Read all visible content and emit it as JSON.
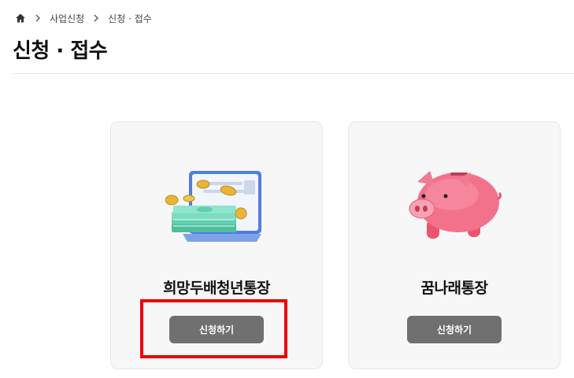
{
  "breadcrumb": {
    "home_icon": "home-icon",
    "separator_icon": "chevron-right-icon",
    "items": [
      "사업신청",
      "신청 · 접수"
    ]
  },
  "page": {
    "title": "신청 · 접수"
  },
  "cards": [
    {
      "name": "희망두배청년통장",
      "button_label": "신청하기",
      "illustration": "money-wallet-illustration"
    },
    {
      "name": "꿈나래통장",
      "button_label": "신청하기",
      "illustration": "piggy-bank-illustration"
    }
  ],
  "colors": {
    "button_bg": "#707070",
    "card_bg": "#f7f7f7",
    "highlight": "#ee0000"
  }
}
